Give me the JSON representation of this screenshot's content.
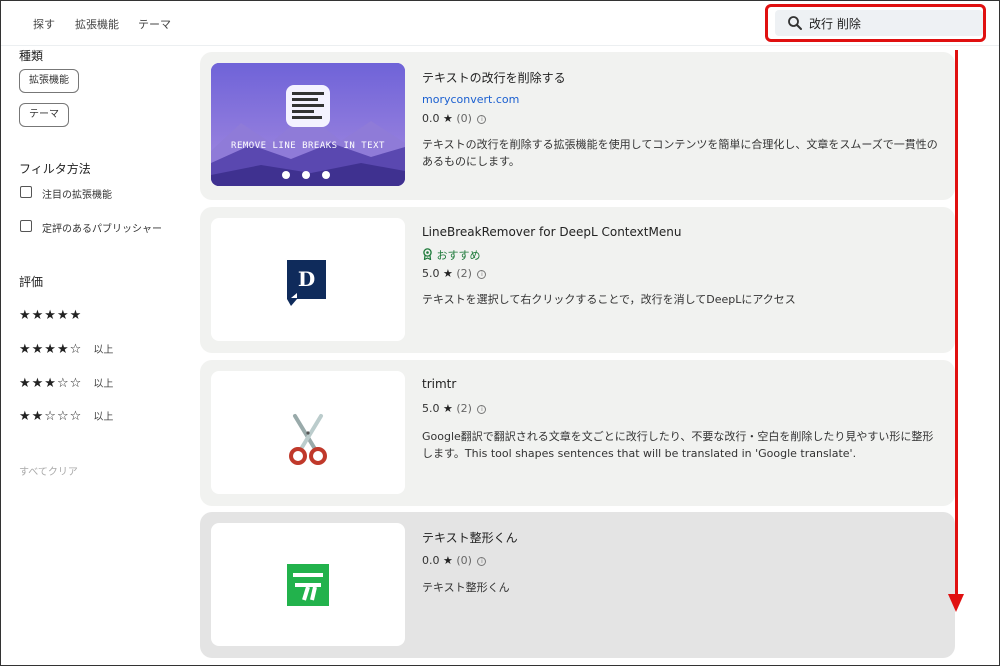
{
  "header": {
    "nav": [
      "探す",
      "拡張機能",
      "テーマ"
    ],
    "search_value": "改行 削除",
    "highlight_color": "#e01010"
  },
  "sidebar": {
    "type_heading": "種類",
    "type_chips": [
      "拡張機能",
      "テーマ"
    ],
    "filter_heading": "フィルタ方法",
    "filters": [
      "注目の拡張機能",
      "定評のあるパブリッシャー"
    ],
    "rating_heading": "評価",
    "ratings": [
      {
        "stars": "★★★★★",
        "suffix": ""
      },
      {
        "stars": "★★★★☆",
        "suffix": "以上"
      },
      {
        "stars": "★★★☆☆",
        "suffix": "以上"
      },
      {
        "stars": "★★☆☆☆",
        "suffix": "以上"
      }
    ],
    "clear_all": "すべてクリア"
  },
  "results": [
    {
      "title": "テキストの改行を削除する",
      "link": "moryconvert.com",
      "score": "0.0",
      "count": "(0)",
      "desc": "テキストの改行を削除する拡張機能を使用してコンテンツを簡単に合理化し、文章をスムーズで一貫性のあるものにします。",
      "thumb_text": "REMOVE LINE BREAKS IN TEXT"
    },
    {
      "title": "LineBreakRemover for DeepL ContextMenu",
      "badge": "おすすめ",
      "score": "5.0",
      "count": "(2)",
      "desc": "テキストを選択して右クリックすることで，改行を消してDeepLにアクセス",
      "thumb_letter": "D"
    },
    {
      "title": "trimtr",
      "score": "5.0",
      "count": "(2)",
      "desc": "Google翻訳で翻訳される文章を文ごとに改行したり、不要な改行・空白を削除したり見やすい形に整形します。This tool shapes sentences that will be translated in 'Google translate'."
    },
    {
      "title": "テキスト整形くん",
      "score": "0.0",
      "count": "(0)",
      "desc": "テキスト整形くん"
    }
  ]
}
